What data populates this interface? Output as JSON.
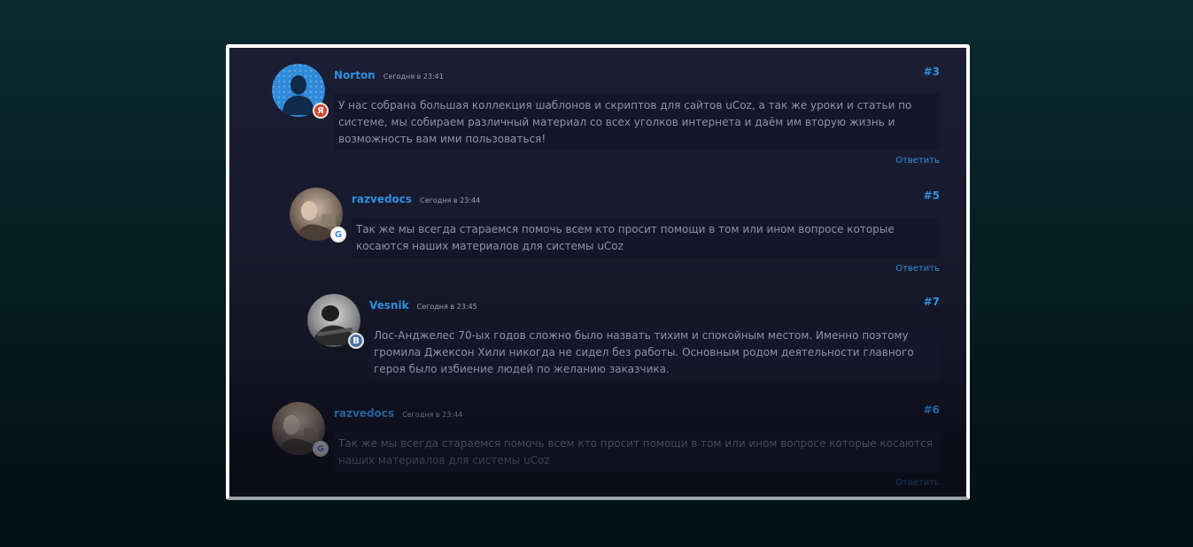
{
  "comments": [
    {
      "author": "Norton",
      "date": "Сегодня в 23:41",
      "number": "#3",
      "text": "У нас собрана большая коллекция шаблонов и скриптов для сайтов uCoz, а так же уроки и статьи по системе, мы собираем различный материал со всех уголков интернета и даём им вторую жизнь и возможность вам ими пользоваться!",
      "reply": "Ответить",
      "social": "Я",
      "social_icon": "yandex-icon"
    },
    {
      "author": "razvedocs",
      "date": "Сегодня в 23:44",
      "number": "#5",
      "text": "Так же мы всегда стараемся помочь всем кто просит помощи в том или ином вопросе которые косаются наших материалов для системы uCoz",
      "reply": "Ответить",
      "social": "G",
      "social_icon": "google-icon"
    },
    {
      "author": "Vesnik",
      "date": "Сегодня в 23:45",
      "number": "#7",
      "text": "Лос-Анджелес 70-ых годов сложно было назвать тихим и спокойным местом. Именно поэтому громила Джексон Хили никогда не сидел без работы. Основным родом деятельности главного героя было избиение людей по желанию заказчика.",
      "reply": "",
      "social": "B",
      "social_icon": "vk-icon"
    },
    {
      "author": "razvedocs",
      "date": "Сегодня в 23:44",
      "number": "#6",
      "text": "Так же мы всегда стараемся помочь всем кто просит помощи в том или ином вопросе которые косаются наших материалов для системы uCoz",
      "reply": "Ответить",
      "social": "G",
      "social_icon": "google-icon"
    }
  ],
  "colors": {
    "accent": "#2f8fe0",
    "panel_bg": "#1b1e33",
    "bubble_bg": "#141729",
    "text": "#8c92a6"
  }
}
